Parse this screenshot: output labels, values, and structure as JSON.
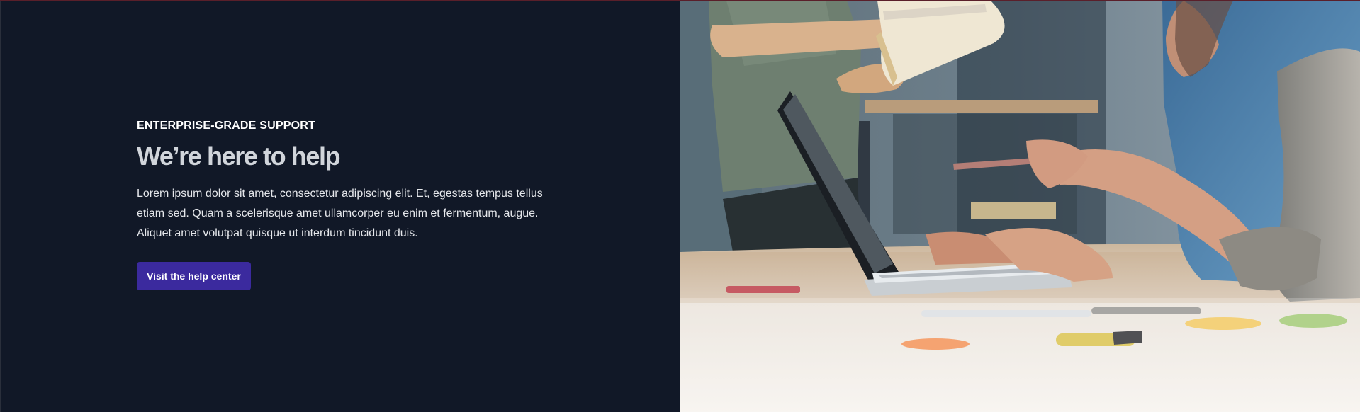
{
  "hero": {
    "eyebrow": "ENTERPRISE-GRADE SUPPORT",
    "title": "We’re here to help",
    "description": "Lorem ipsum dolor sit amet, consectetur adipiscing elit. Et, egestas tempus tellus etiam sed. Quam a scelerisque amet ullamcorper eu enim et fermentum, augue. Aliquet amet volutpat quisque ut interdum tincidunt duis.",
    "cta_label": "Visit the help center"
  },
  "colors": {
    "panel_background": "#111827",
    "heading": "#d1d5db",
    "button_background": "#3b2a9e",
    "button_text": "#ffffff"
  },
  "image": {
    "subject": "team-working-at-laptop-photo"
  }
}
